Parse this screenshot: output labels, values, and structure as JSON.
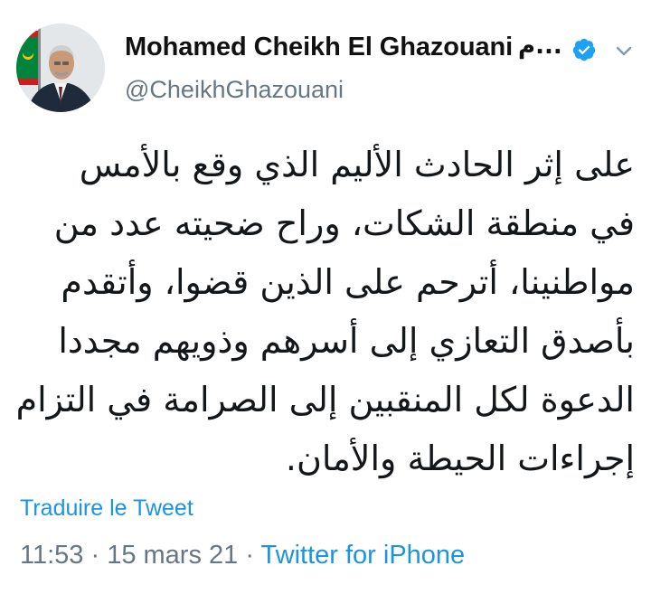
{
  "author": {
    "name": "Mohamed Cheikh El Ghazouani",
    "name_suffix": "م...",
    "handle": "@CheikhGhazouani",
    "verified": true
  },
  "tweet": {
    "lines": [
      "على إثر الحادث الأليم الذي وقع بالأمس",
      "في منطقة الشكات،  وراح ضحيته عدد من",
      "مواطنينا، أترحم على الذين قضوا، وأتقدم",
      "بأصدق التعازي إلى أسرهم وذويهم مجددا",
      "الدعوة لكل المنقبين إلى الصرامة في التزام",
      "إجراءات الحيطة والأمان."
    ]
  },
  "translate_label": "Traduire le Tweet",
  "meta": {
    "time": "11:53",
    "separator": " · ",
    "date": "15 mars 21",
    "source": "Twitter for iPhone"
  },
  "colors": {
    "link": "#1b95e0",
    "secondary_text": "#657786",
    "verified_badge": "#1da1f2"
  },
  "icons": {
    "verified": "verified-badge-icon",
    "more": "chevron-down-icon"
  }
}
